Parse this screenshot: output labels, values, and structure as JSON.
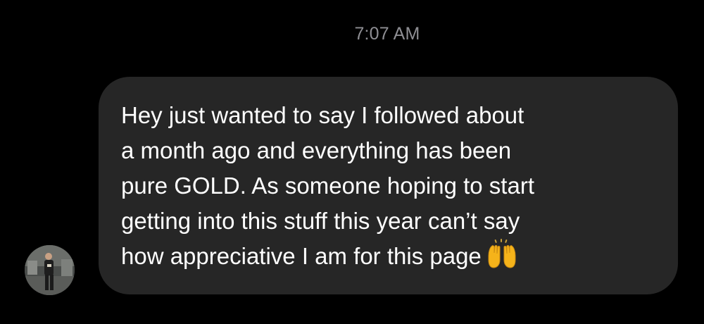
{
  "conversation": {
    "timestamp": "7:07 AM",
    "message": {
      "lines": [
        "Hey just wanted to say I followed about",
        "a month ago and everything has been",
        "pure GOLD. As someone hoping to start",
        "getting into this stuff this year can’t say",
        "how appreciative I am for this page"
      ],
      "emoji": "raising-hands-emoji"
    },
    "sender_avatar": "profile-photo"
  },
  "colors": {
    "background": "#000000",
    "bubble": "#262626",
    "message_text": "#ffffff",
    "timestamp_text": "#8e8e93",
    "emoji": "#f5b31a"
  }
}
